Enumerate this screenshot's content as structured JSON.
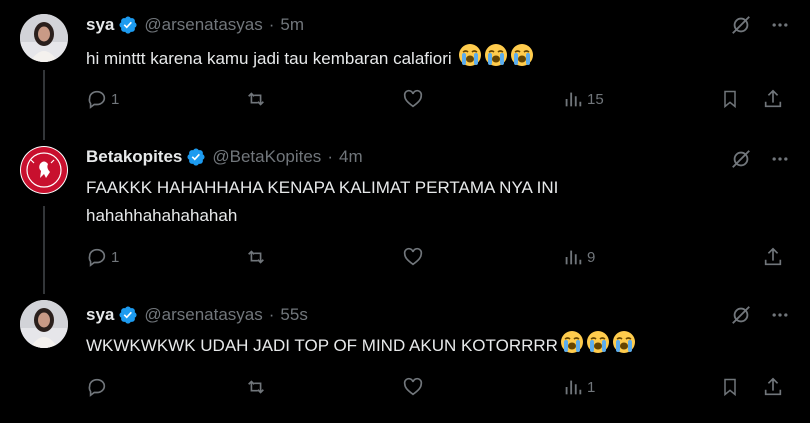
{
  "tweets": [
    {
      "name": "sya",
      "handle": "@arsenatasyas",
      "time": "5m",
      "text": "hi minttt karena kamu jadi tau kembaran calafiori",
      "emojis": [
        "loudly-crying-face",
        "loudly-crying-face",
        "loudly-crying-face"
      ],
      "replies": "1",
      "reposts": "",
      "likes": "",
      "views": "15"
    },
    {
      "name": "Betakopites",
      "handle": "@BetaKopites",
      "time": "4m",
      "text_line1": "FAAKKK HAHAHHAHA KENAPA KALIMAT PERTAMA NYA INI",
      "text_line2": "hahahhahahahahah",
      "replies": "1",
      "reposts": "",
      "likes": "",
      "views": "9"
    },
    {
      "name": "sya",
      "handle": "@arsenatasyas",
      "time": "55s",
      "text": "WKWKWKWK UDAH JADI TOP OF MIND AKUN KOTORRRR",
      "emojis": [
        "loudly-crying-face",
        "loudly-crying-face",
        "loudly-crying-face"
      ],
      "replies": "",
      "reposts": "",
      "likes": "",
      "views": "1"
    }
  ],
  "colors": {
    "background": "#000000",
    "text": "#e7e9ea",
    "secondary": "#71767b",
    "verified": "#1d9bf0",
    "thread_line": "#333639",
    "logo_red": "#c8102e"
  }
}
